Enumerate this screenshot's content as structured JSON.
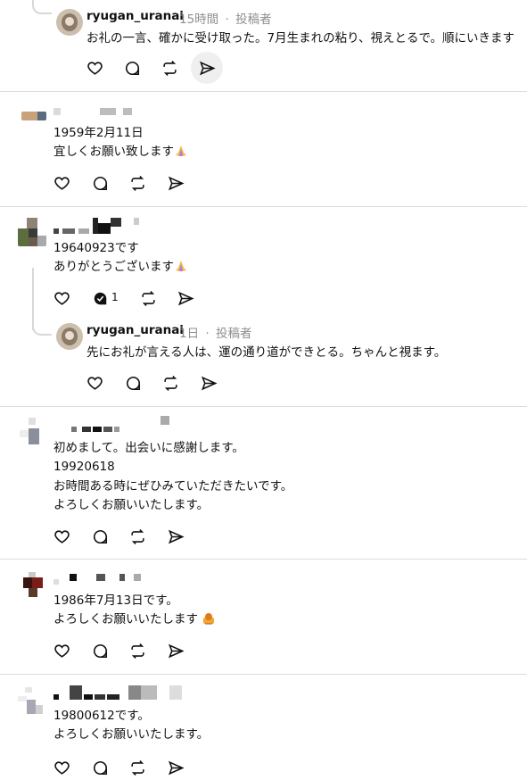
{
  "threads": [
    {
      "reply": {
        "username": "ryugan_uranai",
        "time": "15時間",
        "separator": "·",
        "role": "投稿者",
        "text": "お礼の一言、確かに受け取った。7月生まれの粘り、視えとるで。順にいきます"
      }
    },
    {
      "comment": {
        "lines": [
          "1959年2月11日",
          "宜しくお願い致します"
        ],
        "emoji": "pray-emoji"
      }
    },
    {
      "comment": {
        "lines": [
          "19640923です",
          "ありがとうございます"
        ],
        "emoji": "pray-emoji",
        "reply_count": "1"
      },
      "reply": {
        "username": "ryugan_uranai",
        "time": "1日",
        "separator": "·",
        "role": "投稿者",
        "text": "先にお礼が言える人は、運の通り道ができとる。ちゃんと視ます。"
      }
    },
    {
      "comment": {
        "lines": [
          "初めまして。出会いに感謝します。",
          "19920618",
          "お時間ある時にぜひみていただきたいです。",
          "よろしくお願いいたします。"
        ]
      }
    },
    {
      "comment": {
        "lines": [
          "1986年7月13日です。",
          "よろしくお願いいたします"
        ],
        "emoji": "bow-emoji"
      }
    },
    {
      "comment": {
        "lines": [
          "19800612です。",
          "よろしくお願いいたします。"
        ]
      }
    }
  ],
  "icons": {
    "like": "heart-icon",
    "reply": "comment-icon",
    "repost": "repost-icon",
    "share": "send-icon"
  },
  "colors": {
    "text": "#111111",
    "meta": "#8e8e8e",
    "divider": "#dcdcdc"
  }
}
